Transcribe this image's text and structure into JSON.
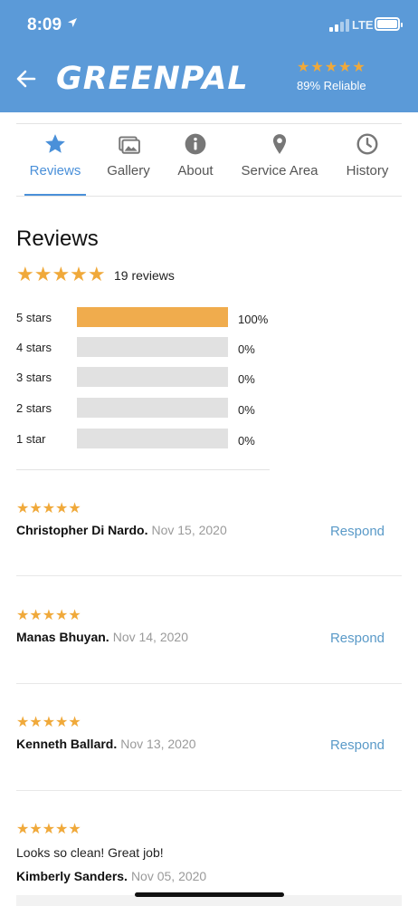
{
  "status": {
    "time": "8:09",
    "network": "LTE"
  },
  "header": {
    "logo": "GREENPAL",
    "stars": "★★★★★",
    "reliable": "89% Reliable",
    "accent": "#5b9ad8",
    "star_color": "#f0a93a"
  },
  "tabs": [
    {
      "label": "Reviews",
      "icon": "star-icon"
    },
    {
      "label": "Gallery",
      "icon": "gallery-icon"
    },
    {
      "label": "About",
      "icon": "info-icon"
    },
    {
      "label": "Service Area",
      "icon": "location-pin-icon"
    },
    {
      "label": "History",
      "icon": "clock-icon"
    }
  ],
  "summary": {
    "title": "Reviews",
    "stars": "★★★★★",
    "count": "19 reviews",
    "distribution": [
      {
        "label": "5 stars",
        "percent": 100,
        "text": "100%"
      },
      {
        "label": "4 stars",
        "percent": 0,
        "text": "0%"
      },
      {
        "label": "3 stars",
        "percent": 0,
        "text": "0%"
      },
      {
        "label": "2 stars",
        "percent": 0,
        "text": "0%"
      },
      {
        "label": "1 star",
        "percent": 0,
        "text": "0%"
      }
    ]
  },
  "reviews": [
    {
      "stars": "★★★★★",
      "name": "Christopher Di Nardo.",
      "date": "Nov 15, 2020",
      "text": "",
      "action": "Respond"
    },
    {
      "stars": "★★★★★",
      "name": "Manas Bhuyan.",
      "date": "Nov 14, 2020",
      "text": "",
      "action": "Respond"
    },
    {
      "stars": "★★★★★",
      "name": "Kenneth Ballard.",
      "date": "Nov 13, 2020",
      "text": "",
      "action": "Respond"
    },
    {
      "stars": "★★★★★",
      "name": "Kimberly Sanders.",
      "date": "Nov 05, 2020",
      "text": "Looks so clean! Great job!",
      "action": ""
    }
  ]
}
